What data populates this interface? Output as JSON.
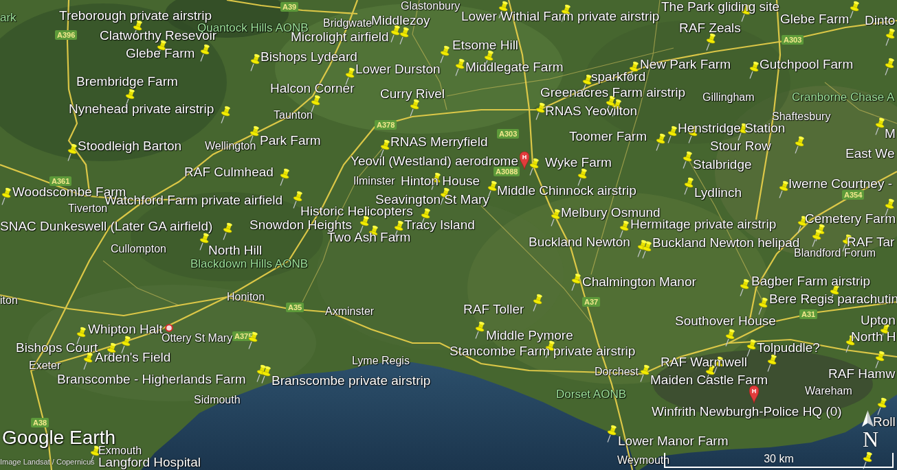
{
  "map": {
    "placemarks": [
      "The Park gliding site",
      "Treborough private airstrip",
      "Middlezoy",
      "Lower Withial Farm private airstrip",
      "Glebe Farm",
      "Dinto",
      "RAF Zeals",
      "Clatworthy Resevoir",
      "Microlight airfield",
      "Etsome Hill",
      "Glebe Farm",
      "Bishops Lydeard",
      "Lower Durston",
      "Middlegate Farm",
      "New Park Farm",
      "Gutchpool Farm",
      "Brembridge Farm",
      "sparkford",
      "Halcon Corner",
      "Curry Rivel",
      "Greenacres Farm airstrip",
      "Nynehead private airstrip",
      "RNAS Yeovilton",
      "Henstridge Station",
      "Toomer Farm",
      "M",
      "Stoodleigh Barton",
      "Park Farm",
      "RNAS Merryfield",
      "Stour Row",
      "East We",
      "Yeovil (Westland) aerodrome",
      "Wyke Farm",
      "Stalbridge",
      "RAF Culmhead",
      "Hinton House",
      "Iwerne Courtney -",
      "Woodscombe Farm",
      "Middle Chinnock airstrip",
      "Lydlinch",
      "Watchford Farm private airfield",
      "Seavington St Mary",
      "Historic Helicopters",
      "Melbury Osmund",
      "Cemetery Farm",
      "SNAC Dunkeswell (Later GA airfield)",
      "Snowdon Heights",
      "Tracy Island",
      "Hermitage private airstrip",
      "Two Ash Farm",
      "Buckland Newton",
      "Buckland Newton helipad",
      "RAF Tar",
      "North Hill",
      "Chalmington Manor",
      "Bagber Farm airstrip",
      "Bere Regis parachutin",
      "RAF Toller",
      "Southover House",
      "Upton",
      "Whipton Halt",
      "Middle Pymore",
      "North H",
      "Bishops Court",
      "Stancombe Farm private airstrip",
      "Tolpuddle?",
      "Arden's Field",
      "RAF Warmwell",
      "Branscombe - Higherlands Farm",
      "Branscombe private airstrip",
      "Maiden Castle Farm",
      "RAF Hamw",
      "Winfrith Newburgh-Police HQ (0)",
      "Roll",
      "Lower Manor Farm",
      "Langford Hospital"
    ],
    "places": [
      "Glastonbury",
      "Bridgwate",
      "Gillingham",
      "Taunton",
      "Shaftesbury",
      "Wellington",
      "Ilminster",
      "Tiverton",
      "Cullompton",
      "Blandford Forum",
      "iton",
      "Honiton",
      "Axminster",
      "Ottery St Mary",
      "Exeter",
      "Lyme Regis",
      "Dorchest",
      "Wareham",
      "Sidmouth",
      "Exmouth",
      "Weymouth"
    ],
    "areas": [
      "ark",
      "Quantock Hills AONB",
      "Cranborne Chase A",
      "Blackdown Hills AONB",
      "Dorset AONB"
    ],
    "road_numbers": [
      "A39",
      "A396",
      "A303",
      "A378",
      "A303",
      "A3088",
      "A361",
      "A354",
      "A35",
      "A37",
      "A31",
      "A375",
      "A38"
    ],
    "markers": [
      {
        "kind": "balloon",
        "glyph": "H"
      },
      {
        "kind": "ring"
      },
      {
        "kind": "balloon",
        "glyph": "H"
      }
    ]
  },
  "overlay": {
    "logo": "Google Earth",
    "attribution": "Image Landsat / Copernicus",
    "compass": "N",
    "scale": "30 km"
  }
}
